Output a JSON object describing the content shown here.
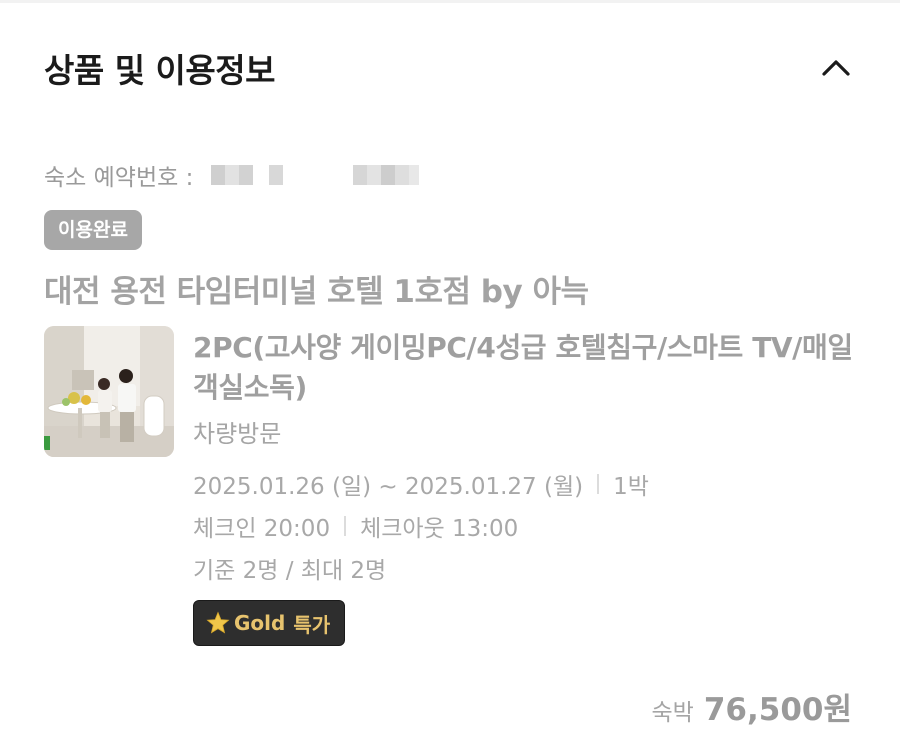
{
  "section": {
    "title": "상품 및 이용정보",
    "collapse_icon": "chevron-up-icon"
  },
  "reservation": {
    "label": "숙소 예약번호 :"
  },
  "status_badge": {
    "label": "이용완료",
    "color": "#a7a7a7"
  },
  "hotel": {
    "name": "대전 용전 타임터미널 호텔 1호점 by 아늑"
  },
  "room": {
    "name": "2PC(고사양 게이밍PC/4성급 호텔침구/스마트 TV/매일 객실소독)",
    "visit_type": "차량방문",
    "dates": "2025.01.26 (일) ~ 2025.01.27 (월)",
    "nights": "1박",
    "checkin": "체크인 20:00",
    "checkout": "체크아웃 13:00",
    "occupancy": "기준 2명 / 최대 2명"
  },
  "promo_badge": {
    "icon": "star-icon",
    "label": "Gold",
    "tag": "특가",
    "bg_color": "#2e2e2e",
    "text_color": "#e7c36e"
  },
  "price": {
    "label": "숙박",
    "value": "76,500원"
  }
}
